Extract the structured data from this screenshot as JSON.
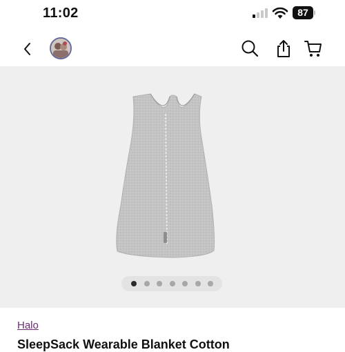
{
  "status": {
    "time": "11:02",
    "battery": "87"
  },
  "nav": {
    "back_icon": "chevron-left-icon",
    "avatar": "profile-avatar",
    "icons": [
      "search-icon",
      "share-icon",
      "cart-icon"
    ]
  },
  "gallery": {
    "image": "gray-sleep-sack-product-photo",
    "image_count": 7,
    "active_index": 0
  },
  "product": {
    "brand": "Halo",
    "title": "SleepSack Wearable Blanket Cotton"
  },
  "colors": {
    "brand_link": "#6b2a73",
    "gallery_bg": "#efefef"
  }
}
